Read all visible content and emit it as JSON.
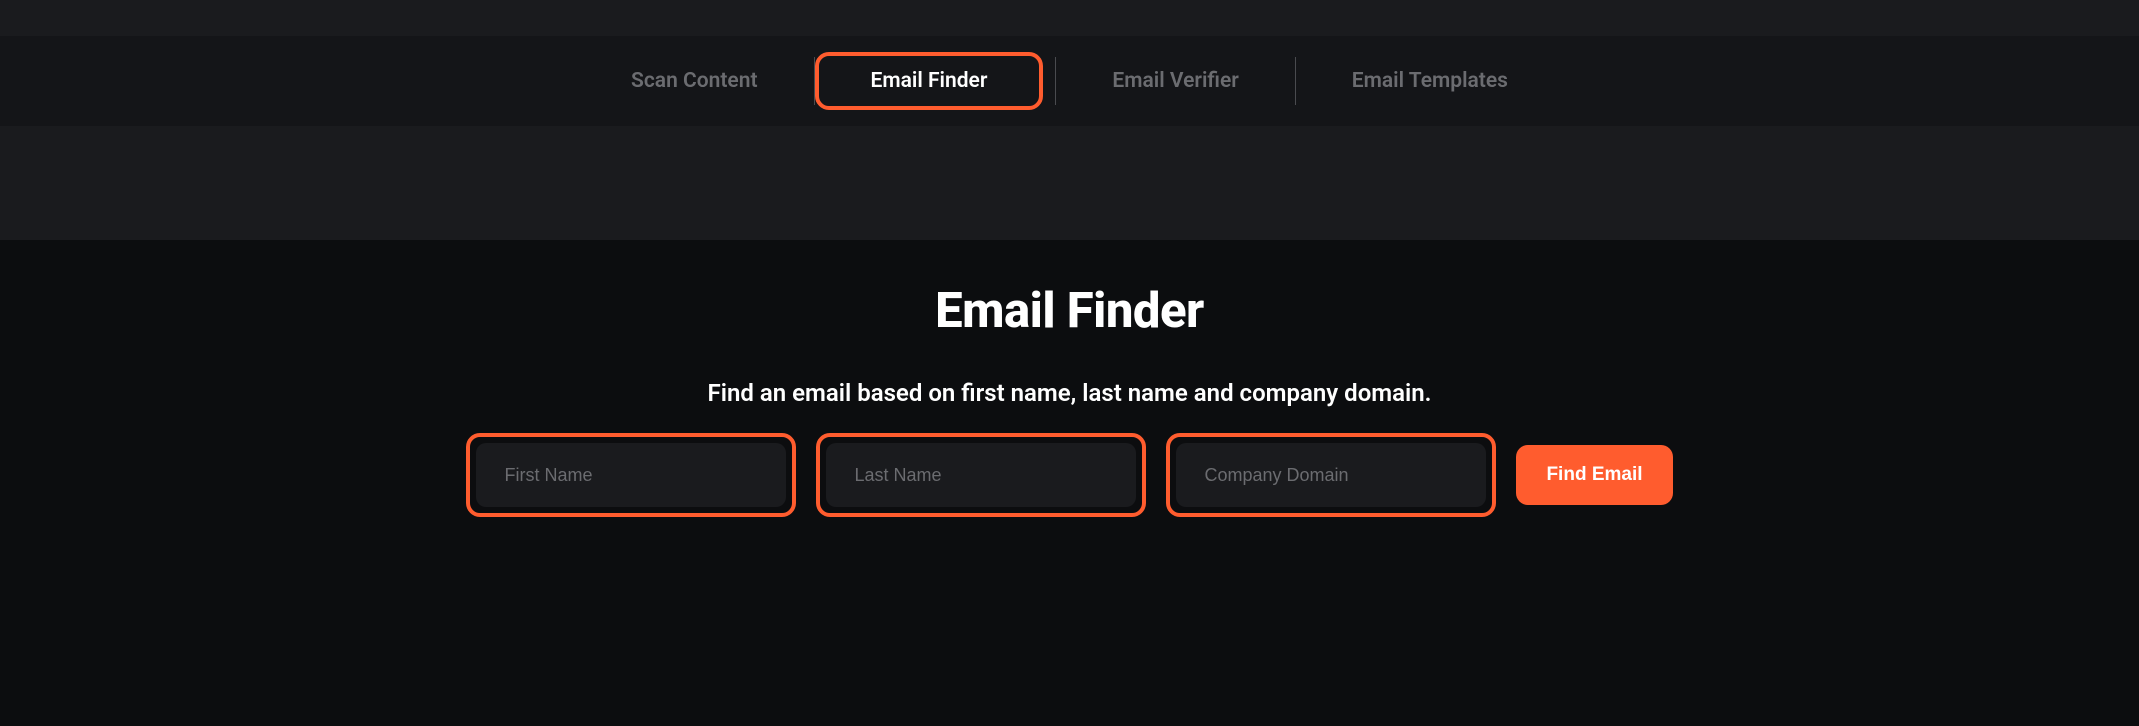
{
  "tabs": {
    "scan_content": "Scan Content",
    "email_finder": "Email Finder",
    "email_verifier": "Email Verifier",
    "email_templates": "Email Templates"
  },
  "main": {
    "heading": "Email Finder",
    "subheading": "Find an email based on first name, last name and company domain."
  },
  "form": {
    "first_name_placeholder": "First Name",
    "last_name_placeholder": "Last Name",
    "company_domain_placeholder": "Company Domain",
    "submit_label": "Find Email"
  }
}
